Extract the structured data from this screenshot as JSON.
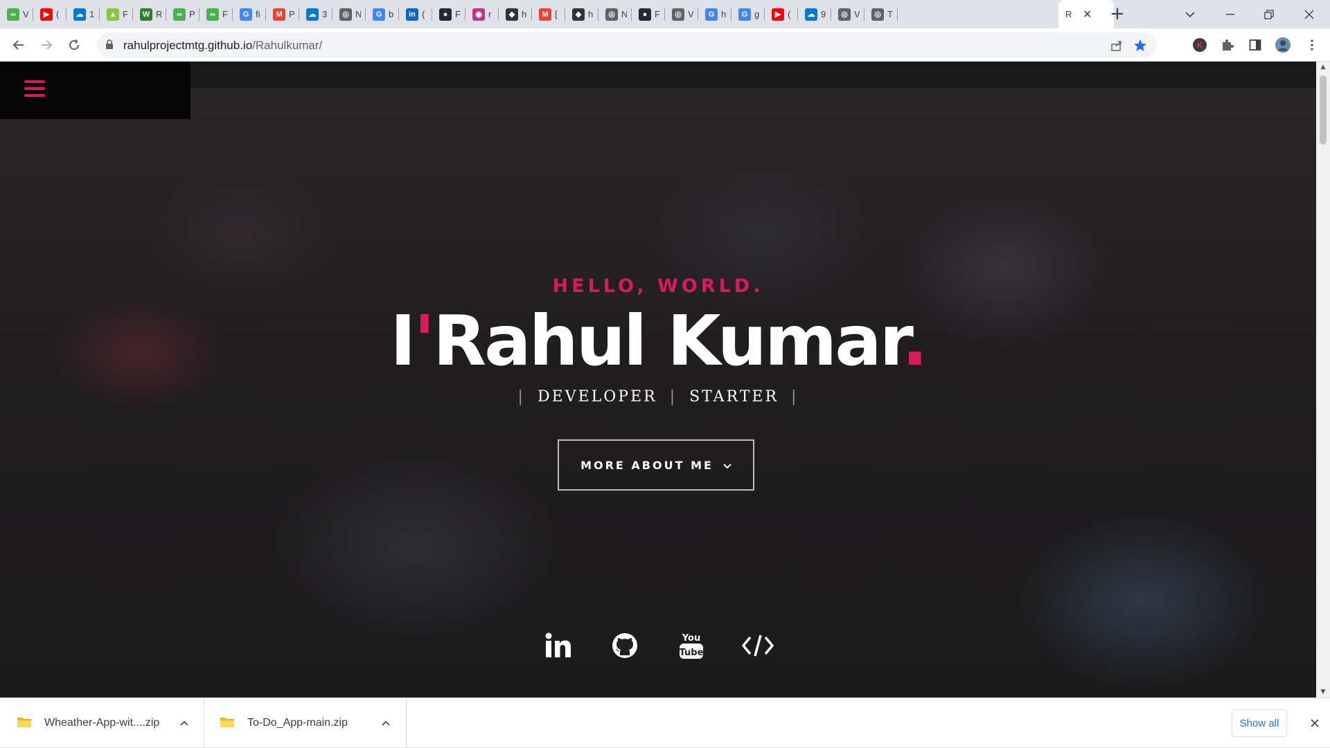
{
  "browser": {
    "tabs": [
      {
        "icon": "infinity-icon",
        "title": "V",
        "color": "#4caf50"
      },
      {
        "icon": "youtube-icon",
        "title": "(",
        "color": "#ff0000"
      },
      {
        "icon": "onedrive-icon",
        "title": "1",
        "color": "#0078d4"
      },
      {
        "icon": "chart-icon",
        "title": "F",
        "color": "#8bc34a"
      },
      {
        "icon": "w-icon",
        "title": "R",
        "color": "#2e7d32"
      },
      {
        "icon": "infinity-icon",
        "title": "P",
        "color": "#4caf50"
      },
      {
        "icon": "infinity-icon",
        "title": "F",
        "color": "#4caf50"
      },
      {
        "icon": "google-icon",
        "title": "fi",
        "color": "#4285f4"
      },
      {
        "icon": "gmail-icon",
        "title": "P",
        "color": "#ea4335"
      },
      {
        "icon": "onedrive-icon",
        "title": "3",
        "color": "#0078d4"
      },
      {
        "icon": "globe-icon",
        "title": "N",
        "color": "#5f6368"
      },
      {
        "icon": "google-icon",
        "title": "b",
        "color": "#4285f4"
      },
      {
        "icon": "linkedin-icon",
        "title": "(",
        "color": "#0a66c2"
      },
      {
        "icon": "github-icon",
        "title": "F",
        "color": "#24292e"
      },
      {
        "icon": "instagram-icon",
        "title": "r",
        "color": "#c13584"
      },
      {
        "icon": "hackerrank-icon",
        "title": "h",
        "color": "#333333"
      },
      {
        "icon": "gmail-icon",
        "title": "[",
        "color": "#ea4335"
      },
      {
        "icon": "hackerrank-icon",
        "title": "h",
        "color": "#333333"
      },
      {
        "icon": "globe-icon",
        "title": "N",
        "color": "#5f6368"
      },
      {
        "icon": "github-icon",
        "title": "F",
        "color": "#24292e"
      },
      {
        "icon": "globe-icon",
        "title": "V",
        "color": "#5f6368"
      },
      {
        "icon": "google-icon",
        "title": "h",
        "color": "#4285f4"
      },
      {
        "icon": "google-icon",
        "title": "g",
        "color": "#4285f4"
      },
      {
        "icon": "youtube-icon",
        "title": "(",
        "color": "#ff0000"
      },
      {
        "icon": "onedrive-icon",
        "title": "9",
        "color": "#0078d4"
      },
      {
        "icon": "globe-icon",
        "title": "V",
        "color": "#5f6368"
      },
      {
        "icon": "globe-icon",
        "title": "T",
        "color": "#5f6368"
      }
    ],
    "active_tab": {
      "title": "R",
      "close": "✕"
    },
    "new_tab": "+",
    "url_host": "rahulprojectmtg.github.io",
    "url_path": "/Rahulkumar/",
    "profile_letter": "K"
  },
  "page": {
    "hello": "HELLO, WORLD.",
    "name_prefix": "I",
    "apostrophe": "'",
    "name": "Rahul Kumar",
    "dot": ".",
    "roles": [
      "DEVELOPER",
      "STARTER"
    ],
    "role_sep": "|",
    "more_button": "MORE ABOUT ME",
    "socials": [
      "linkedin-icon",
      "github-icon",
      "youtube-icon",
      "code-icon"
    ],
    "colors": {
      "accent": "#d81b60",
      "text": "#ffffff"
    }
  },
  "downloads": {
    "items": [
      {
        "name": "Wheather-App-wit....zip"
      },
      {
        "name": "To-Do_App-main.zip"
      }
    ],
    "show_all": "Show all"
  }
}
